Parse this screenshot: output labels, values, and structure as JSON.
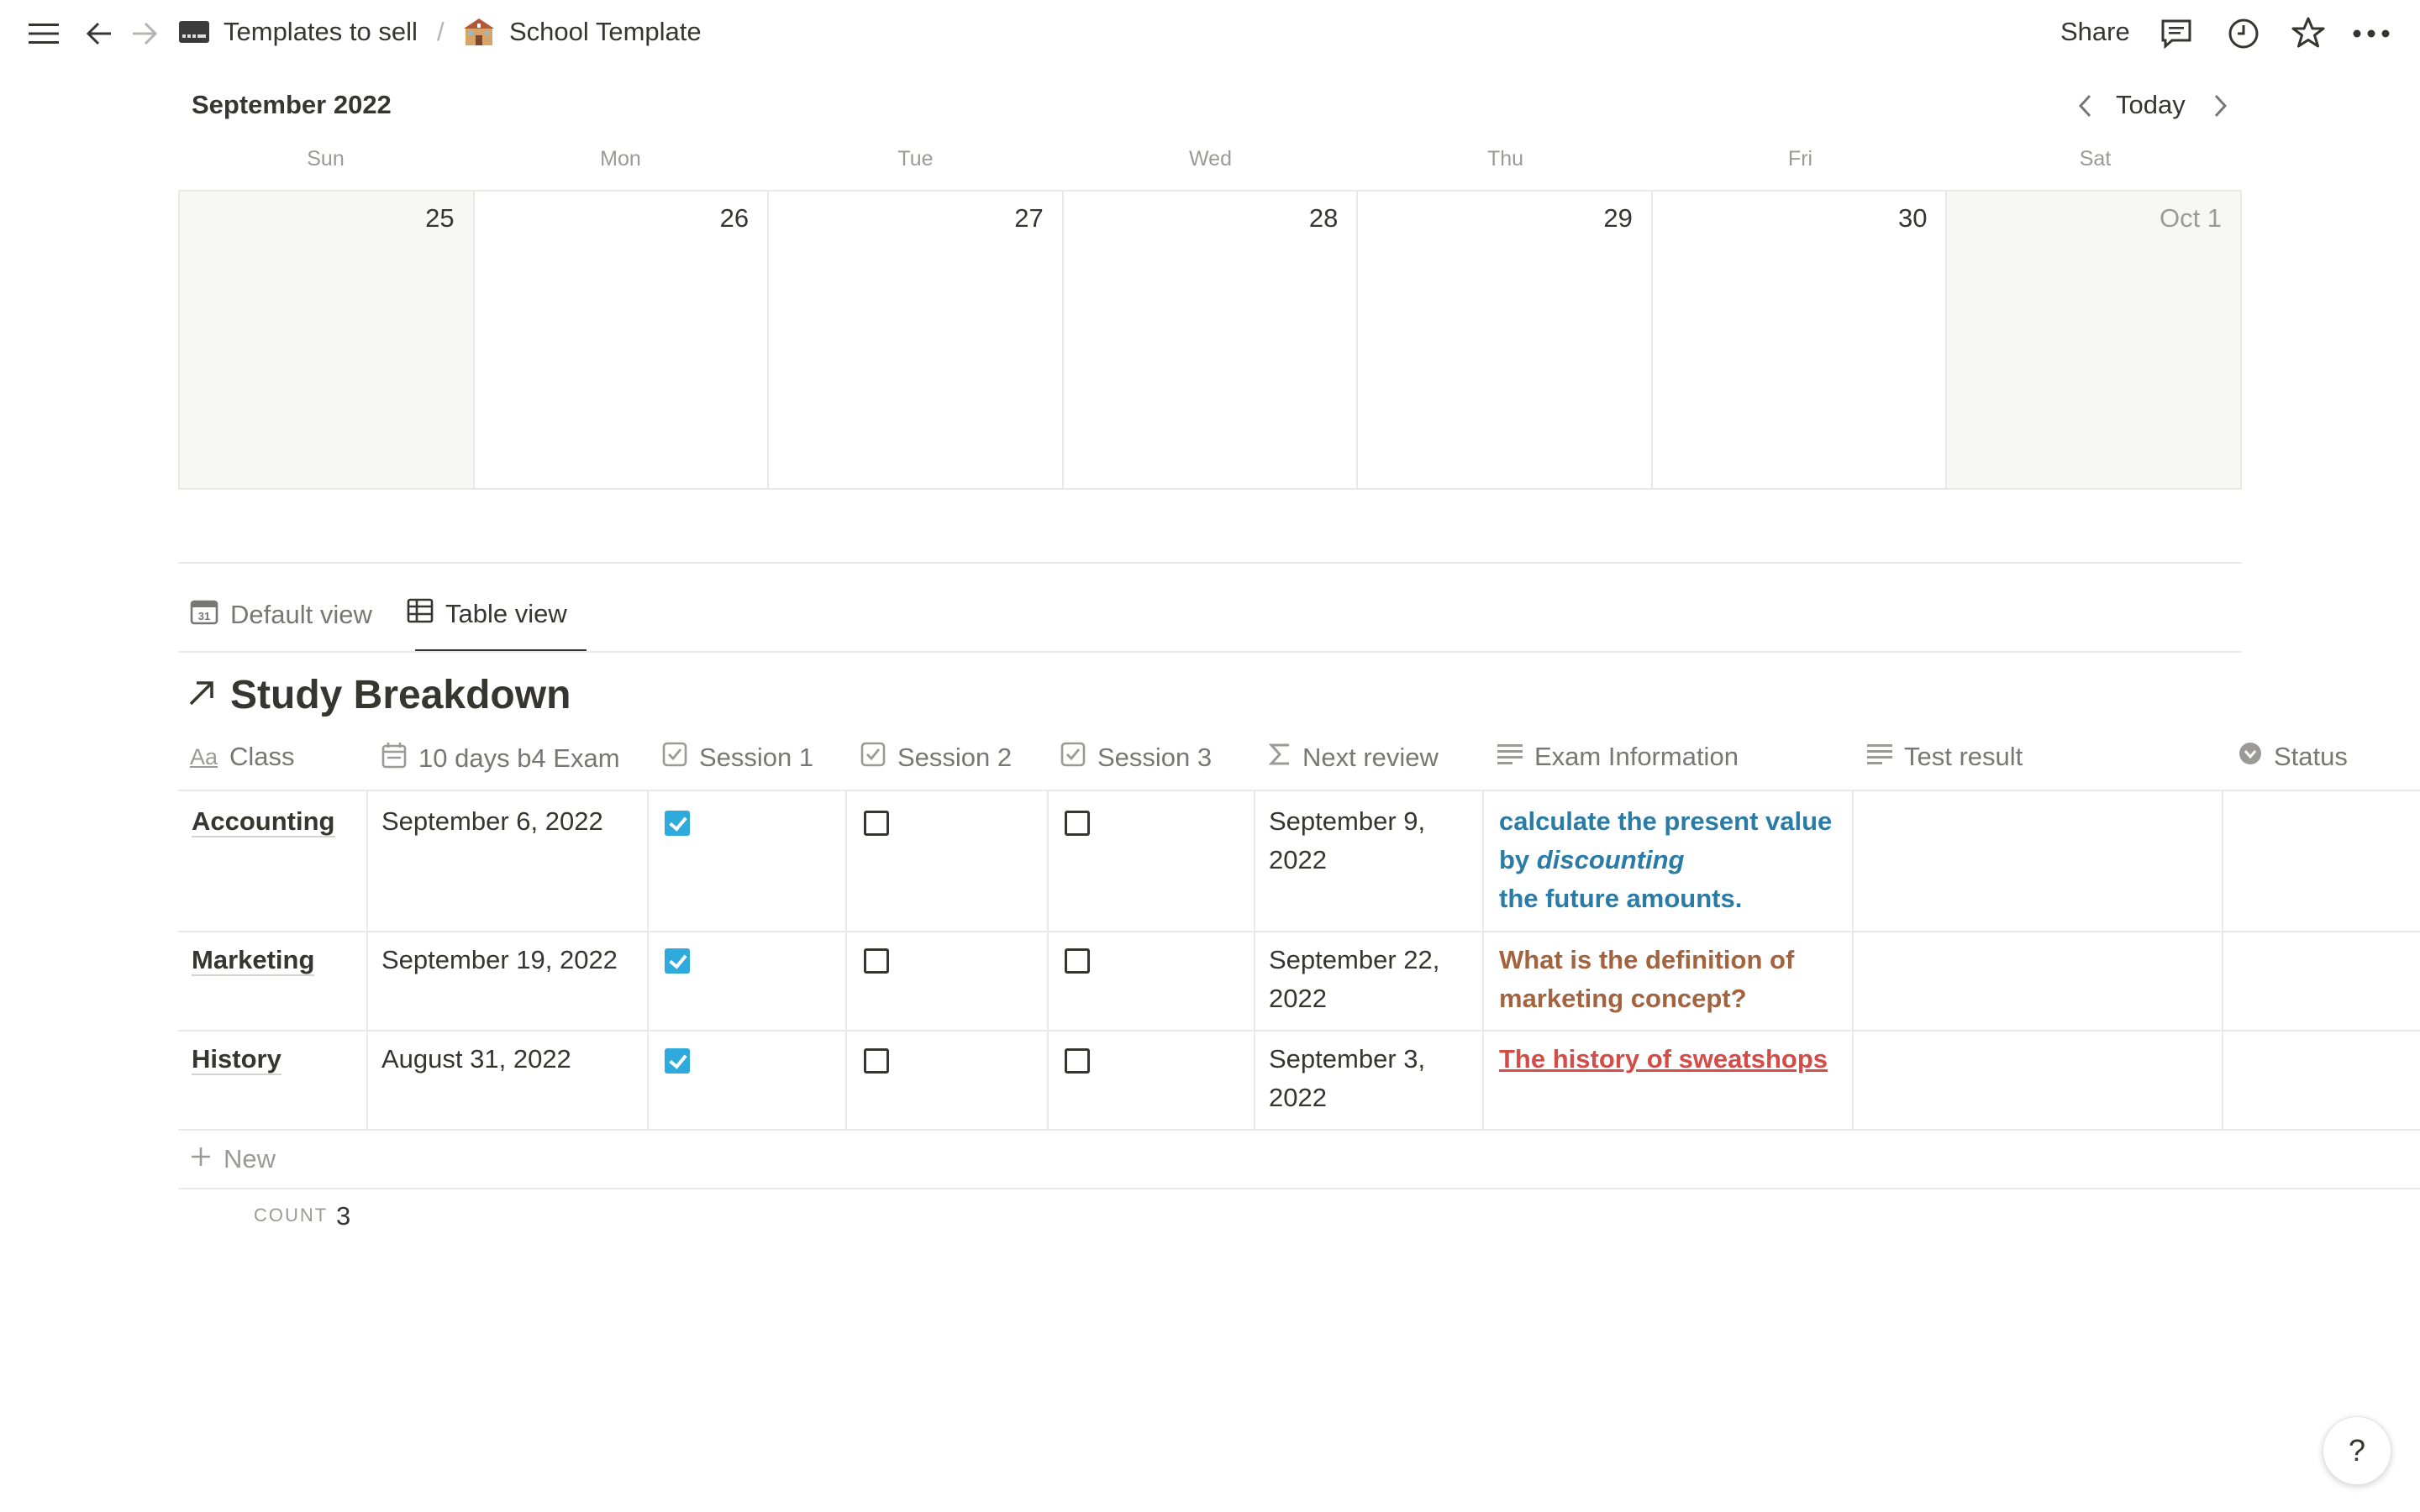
{
  "topbar": {
    "breadcrumb": [
      {
        "label": "Templates to sell",
        "icon": "computer-emoji"
      },
      {
        "label": "School Template",
        "icon": "school-emoji"
      }
    ],
    "separator": "/",
    "share_label": "Share",
    "icons": [
      "menu-icon",
      "back-arrow-icon",
      "forward-arrow-icon",
      "comment-icon",
      "clock-icon",
      "star-icon",
      "more-icon"
    ]
  },
  "calendar": {
    "month": "September 2022",
    "today_label": "Today",
    "weekdays": [
      "Sun",
      "Mon",
      "Tue",
      "Wed",
      "Thu",
      "Fri",
      "Sat"
    ],
    "days": [
      "25",
      "26",
      "27",
      "28",
      "29",
      "30",
      "Oct 1"
    ]
  },
  "views": {
    "tabs": [
      {
        "label": "Default view",
        "icon": "calendar-icon"
      },
      {
        "label": "Table view",
        "icon": "table-icon"
      }
    ],
    "active": "Table view"
  },
  "database": {
    "title": "Study Breakdown",
    "columns": [
      {
        "label": "Class",
        "icon": "text-aa-icon"
      },
      {
        "label": "10 days b4 Exam",
        "icon": "calendar-icon"
      },
      {
        "label": "Session 1",
        "icon": "checkbox-icon"
      },
      {
        "label": "Session 2",
        "icon": "checkbox-icon"
      },
      {
        "label": "Session 3",
        "icon": "checkbox-icon"
      },
      {
        "label": "Next review",
        "icon": "formula-sigma-icon"
      },
      {
        "label": "Exam Information",
        "icon": "text-lines-icon"
      },
      {
        "label": "Test result",
        "icon": "text-lines-icon"
      },
      {
        "label": "Status",
        "icon": "status-icon"
      }
    ],
    "rows": [
      {
        "class": "Accounting",
        "date": "September 6, 2022",
        "s1": true,
        "s2": false,
        "s3": false,
        "next_review": [
          "September 9,",
          "2022"
        ],
        "exam_info": {
          "line1": "calculate the present value",
          "line2a": "by ",
          "line2b": "discounting",
          "line3": "the future amounts.",
          "color": "#2a7ba6"
        },
        "test_result": "",
        "status": ""
      },
      {
        "class": "Marketing",
        "date": "September 19, 2022",
        "s1": true,
        "s2": false,
        "s3": false,
        "next_review": [
          "September 22,",
          "2022"
        ],
        "exam_info": {
          "line1": "What is the definition of",
          "line2": "marketing concept?",
          "color": "#a4633f"
        },
        "test_result": "",
        "status": ""
      },
      {
        "class": "History",
        "date": "August 31, 2022",
        "s1": true,
        "s2": false,
        "s3": false,
        "next_review": [
          "September 3,",
          "2022"
        ],
        "exam_info": {
          "line1": "The history of sweatshops",
          "color": "#d44c47"
        },
        "test_result": "",
        "status": ""
      }
    ],
    "new_label": "New",
    "count_label": "COUNT",
    "count_value": "3"
  },
  "help_label": "?"
}
